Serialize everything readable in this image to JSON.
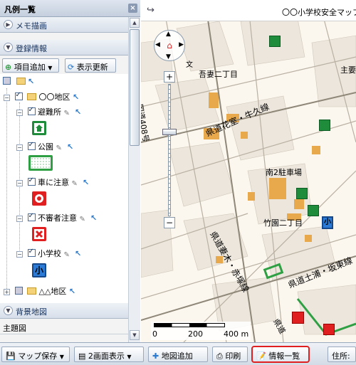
{
  "panel": {
    "title": "凡例一覧",
    "close": "×",
    "memo_section": "メモ描画",
    "registered_section": "登録情報",
    "background_section": "背景地図",
    "theme_section": "主題図"
  },
  "toolbar": {
    "add_item": "項目追加",
    "refresh": "表示更新"
  },
  "tree": {
    "root_label": "〇〇地区",
    "items": [
      {
        "label": "避難所",
        "symbol": "evacuation-icon",
        "color": "#1e8c3a"
      },
      {
        "label": "公園",
        "symbol": "park-icon",
        "color": "#2ea043"
      },
      {
        "label": "車に注意",
        "symbol": "car-warning-icon",
        "color": "#e02020"
      },
      {
        "label": "不審者注意",
        "symbol": "suspicious-icon",
        "color": "#e02020"
      },
      {
        "label": "小学校",
        "symbol": "school-icon",
        "color": "#2b7bd6"
      }
    ],
    "other_area": "△△地区",
    "school_glyph": "小"
  },
  "map": {
    "title": "〇〇小学校安全マップ",
    "labels": {
      "agatsuma": "吾妻二丁目",
      "minami2": "南2駐車場",
      "takezono": "竹園二丁目",
      "route1": "県道花室・牛久線",
      "route2": "県道土浦・坂東線",
      "route3": "県道妻木・赤塚線",
      "route4": "国道408号",
      "shu": "主要",
      "bun": "文",
      "kendo": "県道"
    },
    "scale": {
      "zero": "0",
      "mid": "200",
      "end": "400 m"
    }
  },
  "bottom": {
    "save": "マップ保存",
    "dual": "2画面表示",
    "add_map": "地図追加",
    "print": "印刷",
    "info_list": "情報一覧",
    "address": "住所:"
  }
}
